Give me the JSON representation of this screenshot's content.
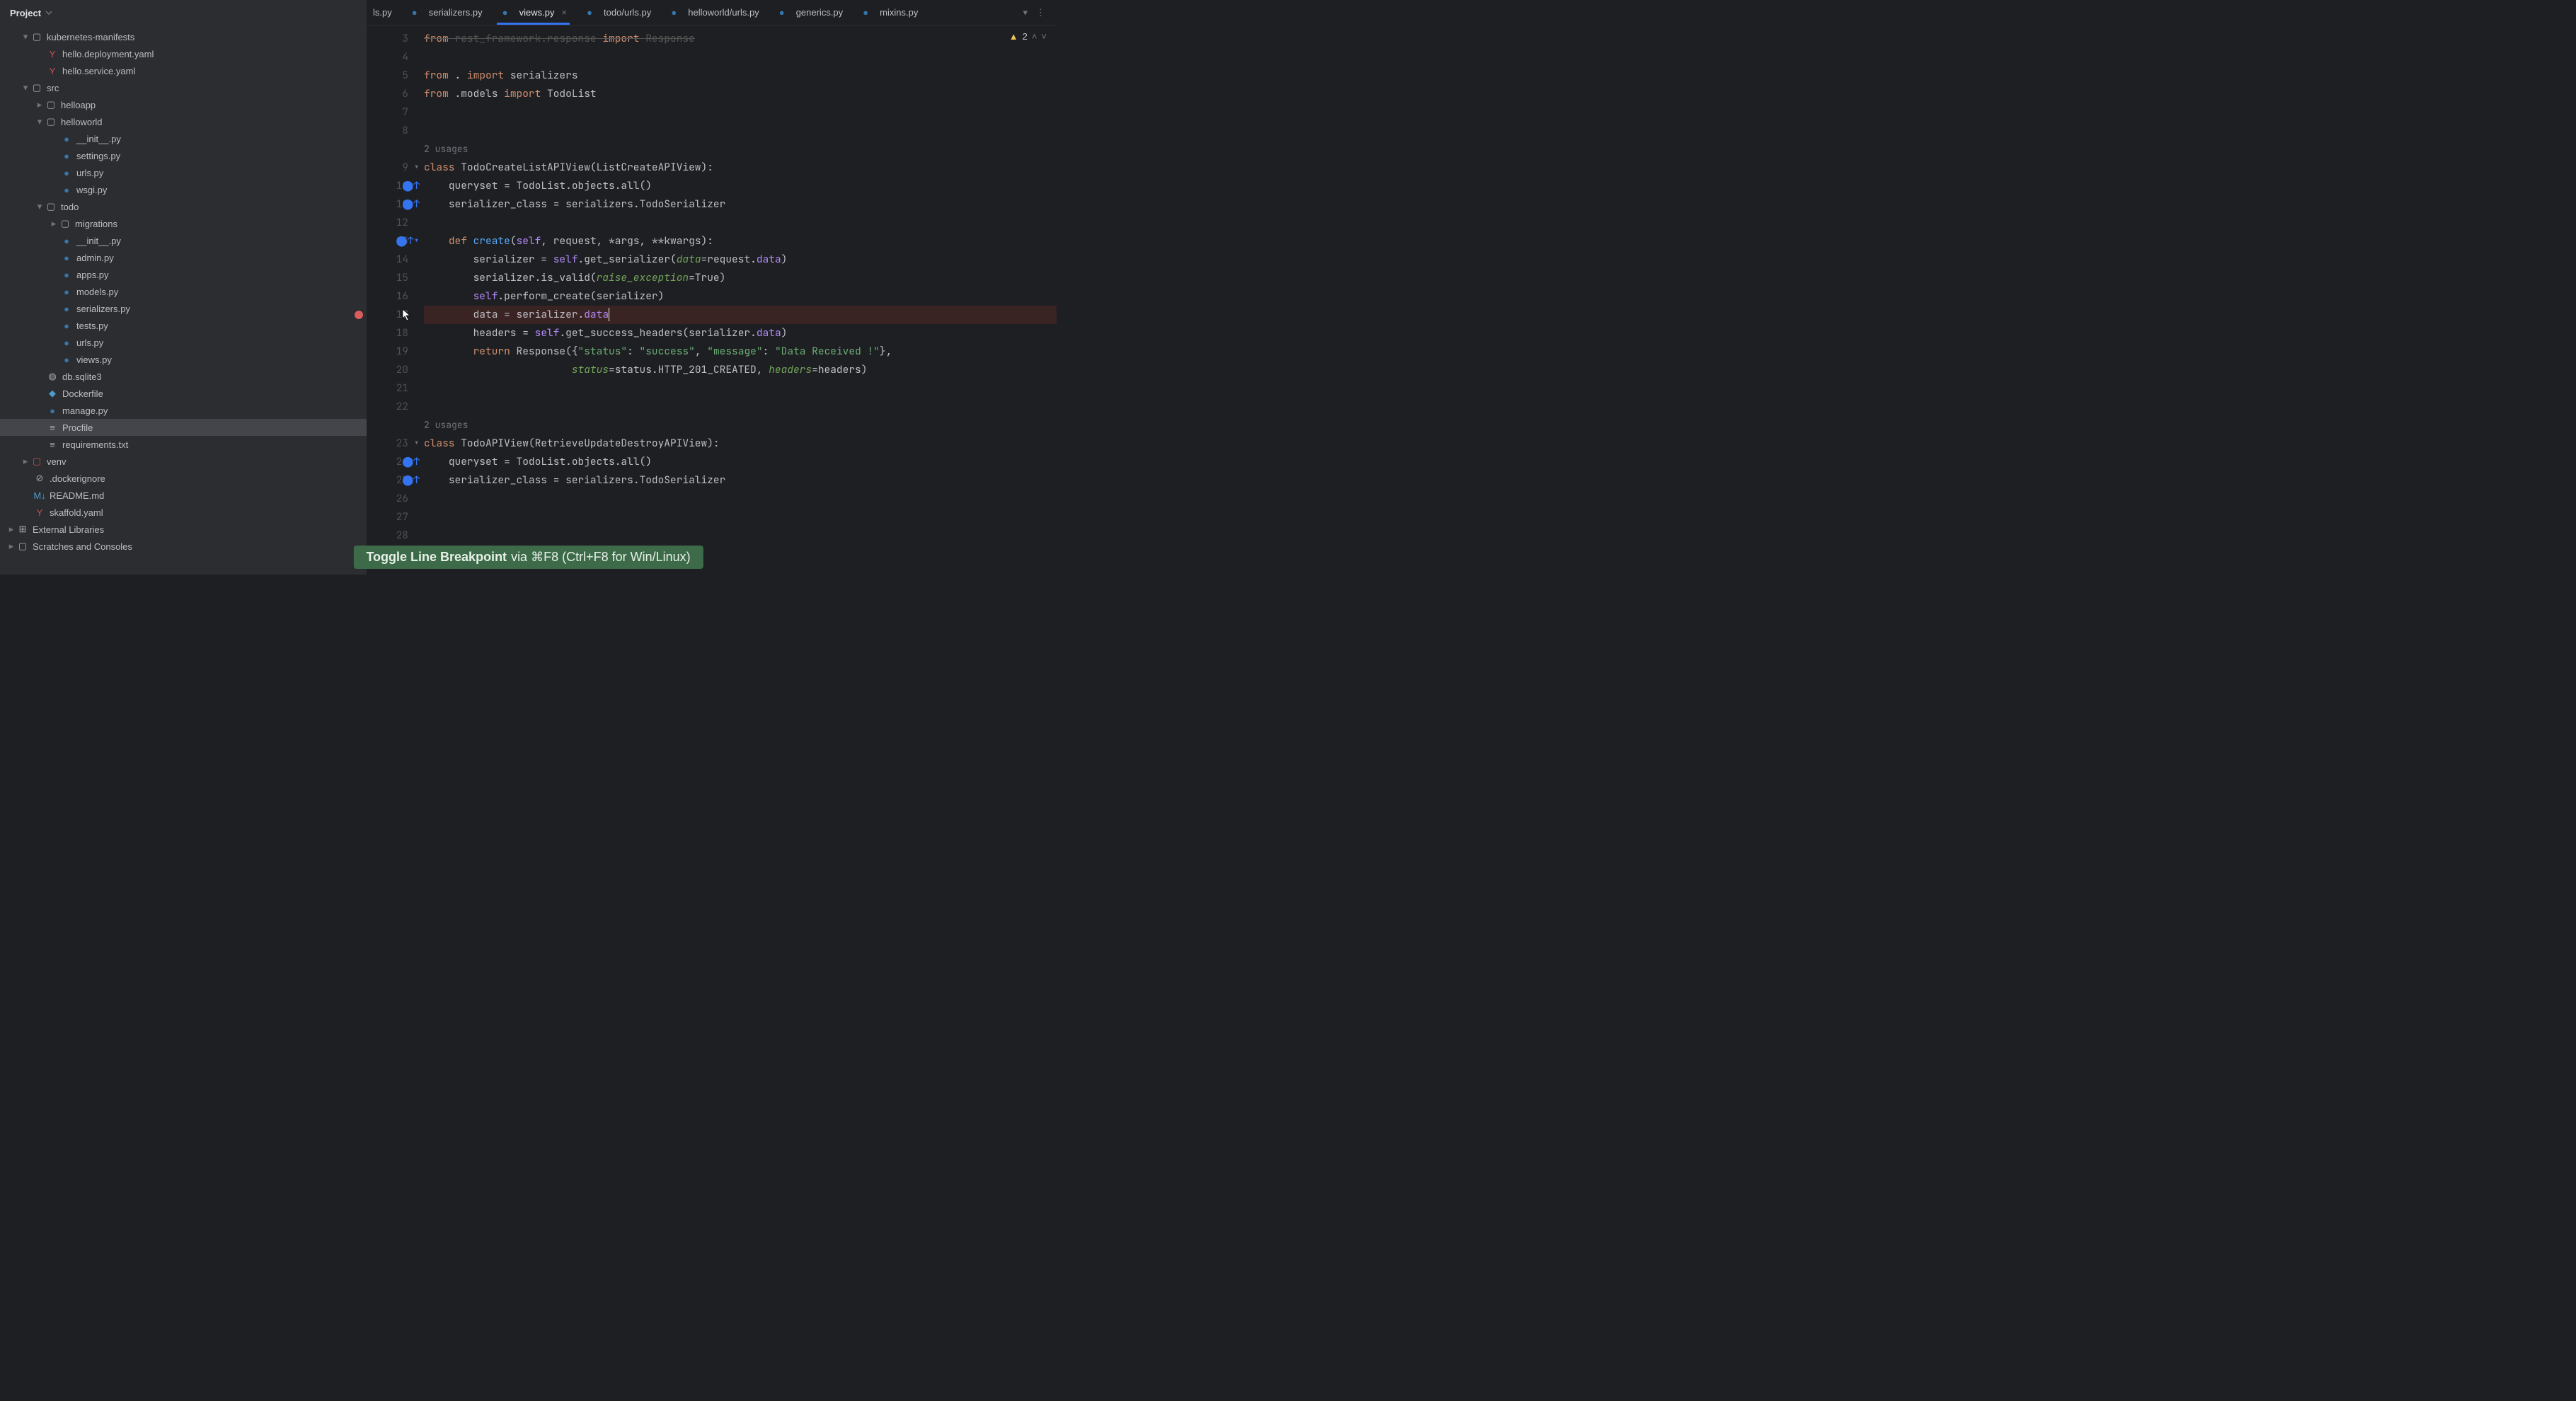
{
  "project_header": "Project",
  "tabs": [
    {
      "label": "ls.py",
      "icon": "python"
    },
    {
      "label": "serializers.py",
      "icon": "python"
    },
    {
      "label": "views.py",
      "icon": "python",
      "active": true,
      "closeable": true
    },
    {
      "label": "todo/urls.py",
      "icon": "python"
    },
    {
      "label": "helloworld/urls.py",
      "icon": "python"
    },
    {
      "label": "generics.py",
      "icon": "python"
    },
    {
      "label": "mixins.py",
      "icon": "python"
    }
  ],
  "inspection": {
    "warnings": "2"
  },
  "tree": {
    "kubernetes_manifests": "kubernetes-manifests",
    "hello_deployment": "hello.deployment.yaml",
    "hello_service": "hello.service.yaml",
    "src": "src",
    "helloapp": "helloapp",
    "helloworld": "helloworld",
    "init_py": "__init__.py",
    "settings_py": "settings.py",
    "urls_py": "urls.py",
    "wsgi_py": "wsgi.py",
    "todo": "todo",
    "migrations": "migrations",
    "admin_py": "admin.py",
    "apps_py": "apps.py",
    "models_py": "models.py",
    "serializers_py": "serializers.py",
    "tests_py": "tests.py",
    "views_py": "views.py",
    "db_sqlite3": "db.sqlite3",
    "dockerfile": "Dockerfile",
    "manage_py": "manage.py",
    "procfile": "Procfile",
    "requirements": "requirements.txt",
    "venv": "venv",
    "dockerignore": ".dockerignore",
    "readme": "README.md",
    "skaffold": "skaffold.yaml",
    "external_libs": "External Libraries",
    "scratches": "Scratches and Consoles"
  },
  "code": {
    "usages_label": "2 usages",
    "line3_partial": "from rest_framework.response import Response",
    "line5": {
      "from": "from",
      "dot": ".",
      "import": "import",
      "mod": "serializers"
    },
    "line6": {
      "from": "from",
      "mod1": ".models",
      "import": "import",
      "mod2": "TodoList"
    },
    "line9": {
      "class": "class",
      "name": "TodoCreateListAPIView",
      "base": "ListCreateAPIView"
    },
    "line10": {
      "lhs": "queryset",
      "rhs": "TodoList.objects.all()"
    },
    "line11": {
      "lhs": "serializer_class",
      "rhs": "serializers.TodoSerializer"
    },
    "line13": {
      "def": "def",
      "name": "create",
      "self": "self",
      "args": ", request, *args, **kwargs"
    },
    "line14": {
      "lhs": "serializer",
      "self": "self",
      "call": ".get_serializer(",
      "kw": "data",
      "eq": "=request.",
      "field": "data",
      "end": ")"
    },
    "line15": {
      "obj": "serializer.is_valid(",
      "kw": "raise_exception",
      "val": "=True)"
    },
    "line16": {
      "self": "self",
      "rest": ".perform_create(serializer)"
    },
    "line17": {
      "lhs": "data",
      "eq": " = serializer.",
      "field": "data"
    },
    "line18": {
      "lhs": "headers",
      "eq": " = ",
      "self": "self",
      "call": ".get_success_headers(serializer.",
      "field": "data",
      "end": ")"
    },
    "line19": {
      "ret": "return",
      "resp": " Response({",
      "k1": "\"status\"",
      "c1": ": ",
      "v1": "\"success\"",
      "s1": ", ",
      "k2": "\"message\"",
      "c2": ": ",
      "v2": "\"Data Received !\"",
      "end": "},"
    },
    "line20": {
      "pad": "                        ",
      "kw1": "status",
      "v1": "=status.HTTP_201_CREATED, ",
      "kw2": "headers",
      "v2": "=headers)"
    },
    "line23": {
      "class": "class",
      "name": "TodoAPIView",
      "base": "RetrieveUpdateDestroyAPIView"
    },
    "line24": {
      "lhs": "queryset",
      "rhs": "TodoList.objects.all()"
    },
    "line25": {
      "lhs": "serializer_class",
      "rhs": "serializers.TodoSerializer"
    }
  },
  "line_numbers": [
    "3",
    "4",
    "5",
    "6",
    "7",
    "8",
    "",
    "9",
    "10",
    "11",
    "12",
    "13",
    "14",
    "15",
    "16",
    "17",
    "18",
    "19",
    "20",
    "21",
    "22",
    "",
    "23",
    "24",
    "25",
    "26",
    "27",
    "28"
  ],
  "tooltip": {
    "bold": "Toggle Line Breakpoint",
    "rest": "via ⌘F8 (Ctrl+F8 for Win/Linux)"
  }
}
